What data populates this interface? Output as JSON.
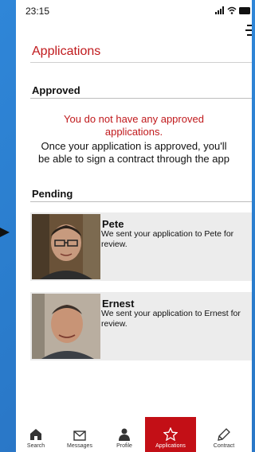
{
  "status": {
    "time": "23:15"
  },
  "header": {
    "title": "Applications"
  },
  "approved": {
    "title": "Approved",
    "empty_message": "You do not have any approved applications.",
    "info_line1": "Once your application is approved, you'll",
    "info_line2": "be able to sign a contract through the app"
  },
  "pending": {
    "title": "Pending",
    "items": [
      {
        "name": "Pete",
        "message": "We sent your application to Pete for review."
      },
      {
        "name": "Ernest",
        "message": "We sent your application to Ernest for review."
      }
    ]
  },
  "tabs": [
    {
      "label": "Search",
      "icon": "home-icon"
    },
    {
      "label": "Messages",
      "icon": "envelope-icon"
    },
    {
      "label": "Profile",
      "icon": "person-icon"
    },
    {
      "label": "Applications",
      "icon": "star-icon",
      "active": true
    },
    {
      "label": "Contract",
      "icon": "pen-icon"
    }
  ],
  "colors": {
    "accent": "#c30f16",
    "background": "#2a7ccc"
  }
}
